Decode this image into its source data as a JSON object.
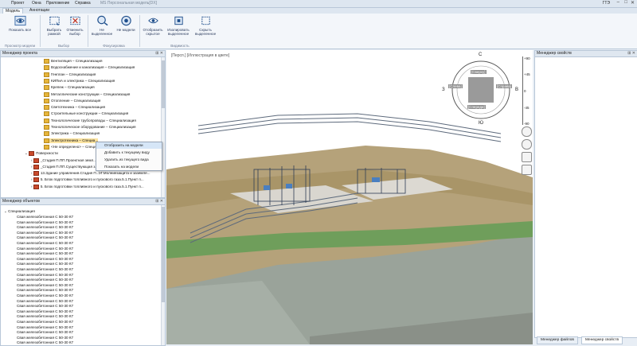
{
  "menu": {
    "items": [
      "Проект",
      "Окна",
      "Приложение",
      "Справка"
    ],
    "app_title": "MS Персональная модель[DX]",
    "language": "ГТЭ"
  },
  "window_controls": {
    "minimize": "–",
    "maximize": "□",
    "close": "✕"
  },
  "tabs": [
    "Модель",
    "Аннотации"
  ],
  "ribbon": {
    "show_all": "Показать все",
    "select_frame": "Выбрать рамкой",
    "deselect": "Отменить выбор",
    "not_selected": "Не выделенное",
    "not_model": "Не модели",
    "show_hidden": "Отобразить скрытое",
    "isolate_selected": "Изолировать выделенное",
    "hide_selected": "Скрыть выделенное",
    "groups": {
      "viewer": "Просмотр модели",
      "select": "Выбор",
      "focus": "Фокусировка",
      "visibility": "Видимость"
    }
  },
  "project_manager": {
    "title": "Менеджер проекта",
    "items": [
      "Вентиляция – Специализация",
      "Водоснабжение и канализация – Специализация",
      "Генплан – Специализация",
      "КИПиА и электрика – Специализация",
      "Крепеж – Специализация",
      "Металлические конструкции – Специализация",
      "Отопление – Специализация",
      "Светотехника – Специализация",
      "Строительные конструкции – Специализация",
      "Технологические трубопроводы – Специализация",
      "Технологическое оборудование – Специализация",
      "Электрика – Специализация",
      "Электротехника – Специа...",
      "<Не определено> – Специ..."
    ],
    "surfaces_label": "Поверхности",
    "surfaces": [
      "_Стадия П.ПП.Проектная земл...",
      "_Стадия П.ПП.Существующая з...",
      "13.Здание управления.Стадия П..ЭГ.Молниезащита и заземле...",
      "5. Блок подготовки топливного и пускового газа.5.1.Пункт п...",
      "5. Блок подготовки топливного и пускового газа.5.1.Пункт п..."
    ]
  },
  "context_menu": [
    "Отобразить на модели",
    "Добавить к текущему виду",
    "Удалить из текущего вида",
    "Показать на модели"
  ],
  "object_manager": {
    "title": "Менеджер объектов",
    "root": "Специализация",
    "rows": [
      "Свая железобетонная С 50-30 К7",
      "Свая железобетонная С 50-30 К7",
      "Свая железобетонная С 50-30 К7",
      "Свая железобетонная С 50-30 К7",
      "Свая железобетонная С 50-30 К7",
      "Свая железобетонная С 50-30 К7",
      "Свая железобетонная С 50-30 К7",
      "Свая железобетонная С 50-30 К7",
      "Свая железобетонная С 50-30 К7",
      "Свая железобетонная С 50-30 К7",
      "Свая железобетонная С 50-30 К7",
      "Свая железобетонная С 50-30 К7",
      "Свая железобетонная С 50-30 К7",
      "Свая железобетонная С 50-30 К7",
      "Свая железобетонная С 50-30 К7",
      "Свая железобетонная С 50-30 К7",
      "Свая железобетонная С 50-30 К7",
      "Свая железобетонная С 50-30 К7",
      "Свая железобетонная С 50-30 К7",
      "Свая железобетонная С 50-30 К7",
      "Свая железобетонная С 50-30 К7",
      "Свая железобетонная С 50-30 К7",
      "Свая железобетонная С 50-30 К7",
      "Свая железобетонная С 50-30 К7",
      "Свая железобетонная С 50-30 К7"
    ]
  },
  "viewport": {
    "caption": "[Персп.] [Иллюстрация в цвете]",
    "compass": {
      "north": "С",
      "south": "Ю",
      "west": "З",
      "east": "В",
      "top": "[Сверху]",
      "left": "[Слева]",
      "right": "[Справа]",
      "front": "[Спереди]"
    },
    "scale_labels": [
      "+90",
      "+45",
      "0",
      "-45",
      "-90"
    ]
  },
  "properties": {
    "title": "Менеджер свойств"
  },
  "bottom_tabs": [
    "Менеджер файлов",
    "Менеджер свойств"
  ]
}
